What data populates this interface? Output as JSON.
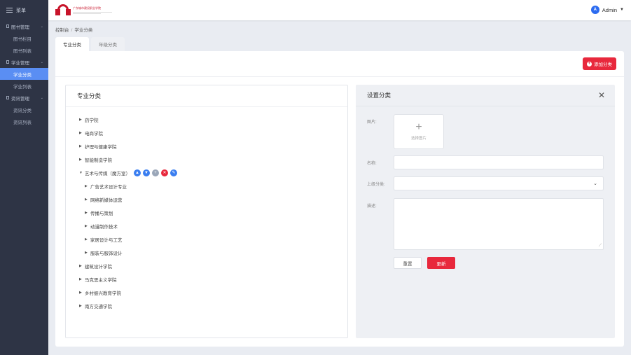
{
  "sidebar": {
    "menu_label": "菜单",
    "groups": [
      {
        "label": "图书管理",
        "items": [
          {
            "label": "图书栏目"
          },
          {
            "label": "图书列表"
          }
        ]
      },
      {
        "label": "学业管理",
        "items": [
          {
            "label": "学业分类"
          },
          {
            "label": "学业列表"
          }
        ]
      },
      {
        "label": "资讯管理",
        "items": [
          {
            "label": "资讯分类"
          },
          {
            "label": "资讯列表"
          }
        ]
      }
    ]
  },
  "topbar": {
    "logo_text": "广东城市建设职业学院",
    "user": {
      "initial": "A",
      "name": "Admin"
    }
  },
  "breadcrumb": [
    "控制台",
    "学业分类"
  ],
  "tabs": [
    {
      "label": "专业分类"
    },
    {
      "label": "年级分类"
    }
  ],
  "toolbar": {
    "add_label": "添加分类"
  },
  "tree": {
    "title": "专业分类",
    "nodes": [
      {
        "label": "药学院"
      },
      {
        "label": "电商学院"
      },
      {
        "label": "护理与健康学院"
      },
      {
        "label": "智能制造学院"
      },
      {
        "label": "艺术与传媒（魔方室）",
        "expanded": true,
        "children": [
          {
            "label": "广告艺术设计专业"
          },
          {
            "label": "网络新媒体运营"
          },
          {
            "label": "传播与策划"
          },
          {
            "label": "动漫制作技术"
          },
          {
            "label": "家居设计与工艺"
          },
          {
            "label": "服装与服饰设计"
          }
        ]
      },
      {
        "label": "建筑设计学院"
      },
      {
        "label": "马克思主义学院"
      },
      {
        "label": "乡村振兴教育学院"
      },
      {
        "label": "南方交通学院"
      }
    ]
  },
  "form": {
    "title": "设置分类",
    "image_label": "图片:",
    "upload_caption": "选择图片",
    "name_label": "名称:",
    "parent_label": "上级分类:",
    "desc_label": "描述:",
    "reset_label": "重置",
    "update_label": "更新"
  }
}
